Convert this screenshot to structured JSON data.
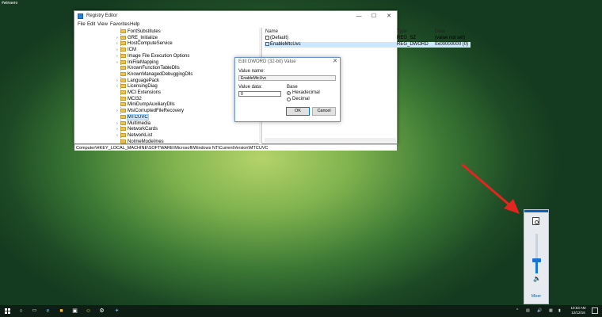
{
  "desktop": {
    "corner_label": "#winaero"
  },
  "registry": {
    "title": "Registry Editor",
    "window_buttons": {
      "minimize": "—",
      "maximize": "☐",
      "close": "✕"
    },
    "menu": [
      "File",
      "Edit",
      "View",
      "Favorites",
      "Help"
    ],
    "tree_items": [
      {
        "label": "FontSubstitutes",
        "expandable": false
      },
      {
        "label": "GRE_Initialize",
        "expandable": true
      },
      {
        "label": "HostComputeService",
        "expandable": true
      },
      {
        "label": "ICM",
        "expandable": true
      },
      {
        "label": "Image File Execution Options",
        "expandable": true
      },
      {
        "label": "IniFileMapping",
        "expandable": true
      },
      {
        "label": "KnownFunctionTableDlls",
        "expandable": false
      },
      {
        "label": "KnownManagedDebuggingDlls",
        "expandable": false
      },
      {
        "label": "LanguagePack",
        "expandable": true
      },
      {
        "label": "LicensingDiag",
        "expandable": true
      },
      {
        "label": "MCI Extensions",
        "expandable": false
      },
      {
        "label": "MCI32",
        "expandable": false
      },
      {
        "label": "MiniDumpAuxiliaryDlls",
        "expandable": false
      },
      {
        "label": "MsiCorruptedFileRecovery",
        "expandable": true
      },
      {
        "label": "MTCUVC",
        "expandable": false,
        "selected": true
      },
      {
        "label": "Multimedia",
        "expandable": true
      },
      {
        "label": "NetworkCards",
        "expandable": true
      },
      {
        "label": "NetworkList",
        "expandable": true
      },
      {
        "label": "NoImeModeImes",
        "expandable": false
      }
    ],
    "columns": {
      "name": "Name",
      "type": "Type",
      "data": "Data"
    },
    "values": [
      {
        "name": "(Default)",
        "type": "REG_SZ",
        "data": "(value not set)"
      },
      {
        "name": "EnableMtcUvc",
        "type": "REG_DWORD",
        "data": "0x00000000 (0)",
        "selected": true
      }
    ],
    "status_path": "Computer\\HKEY_LOCAL_MACHINE\\SOFTWARE\\Microsoft\\Windows NT\\CurrentVersion\\MTCUVC"
  },
  "dialog": {
    "title": "Edit DWORD (32-bit) Value",
    "close": "✕",
    "value_name_label": "Value name:",
    "value_name": "EnableMtcUvc",
    "value_data_label": "Value data:",
    "value_data": "0",
    "base_label": "Base",
    "base_options": [
      "Hexadecimal",
      "Decimal"
    ],
    "base_selected": "Hexadecimal",
    "ok": "OK",
    "cancel": "Cancel"
  },
  "volume_flyout": {
    "level_percent": 35,
    "mixer_label": "Mixer",
    "accent_color": "#0a5fb8"
  },
  "taskbar": {
    "clock_time": "10:53 AM",
    "clock_date": "12/12/16",
    "icons": [
      "windows-logo",
      "search",
      "task-view",
      "edge",
      "file-explorer",
      "store",
      "emoji-app",
      "settings",
      "twitter"
    ]
  },
  "colors": {
    "accent": "#0078d7",
    "arrow": "#e0261f"
  }
}
